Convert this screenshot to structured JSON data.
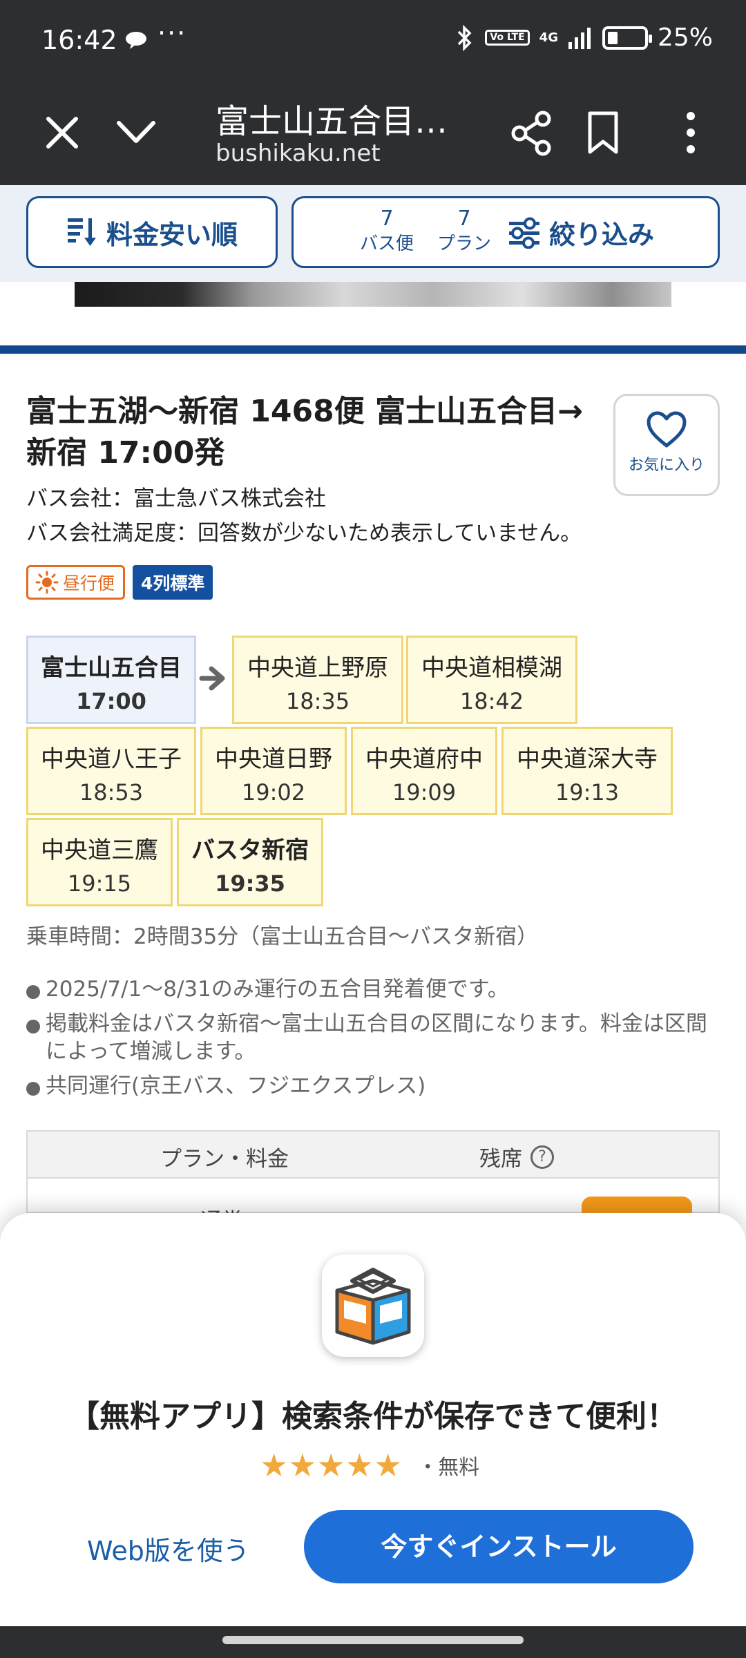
{
  "status_bar": {
    "time": "16:42",
    "more": "···",
    "network": "4G",
    "volte": "Vo LTE",
    "battery": "25%"
  },
  "browser": {
    "title": "富士山五合目…",
    "url": "bushikaku.net"
  },
  "toolbar": {
    "sort_label": "料金安い順",
    "bus_count": "7",
    "bus_count_label": "バス便",
    "plan_count": "7",
    "plan_count_label": "プラン",
    "filter_label": "絞り込み"
  },
  "route": {
    "title": "富士五湖〜新宿 1468便 富士山五合目→新宿 17:00発",
    "company": "バス会社：富士急バス株式会社",
    "satisfaction": "バス会社満足度：回答数が少ないため表示していません。",
    "tag_day": "昼行便",
    "tag_seat": "4列標準",
    "favorite_label": "お気に入り",
    "stops": [
      {
        "name": "富士山五合目",
        "time": "17:00"
      },
      {
        "name": "中央道上野原",
        "time": "18:35"
      },
      {
        "name": "中央道相模湖",
        "time": "18:42"
      },
      {
        "name": "中央道八王子",
        "time": "18:53"
      },
      {
        "name": "中央道日野",
        "time": "19:02"
      },
      {
        "name": "中央道府中",
        "time": "19:09"
      },
      {
        "name": "中央道深大寺",
        "time": "19:13"
      },
      {
        "name": "中央道三鷹",
        "time": "19:15"
      },
      {
        "name": "バスタ新宿",
        "time": "19:35"
      }
    ],
    "ride_time": "乗車時間：2時間35分（富士山五合目〜バスタ新宿）",
    "notes": [
      "2025/7/1〜8/31のみ運行の五合目発着便です。",
      "掲載料金はバスタ新宿〜富士山五合目の区間になります。料金は区間によって増減します。",
      "共同運行(京王バス、フジエクスプレス)"
    ]
  },
  "plan_table": {
    "col_plan": "プラン・料金",
    "col_seats": "残席",
    "help": "?",
    "row_label": "通常"
  },
  "app_sheet": {
    "title": "【無料アプリ】検索条件が保存できて便利！",
    "rating": 4.5,
    "stars": "★★★★★",
    "price": "・無料",
    "web_link": "Web版を使う",
    "install": "今すぐインストール"
  }
}
